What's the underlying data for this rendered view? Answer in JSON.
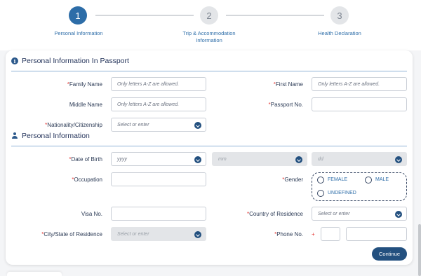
{
  "stepper": {
    "steps": [
      {
        "number": "1",
        "label": "Personal Information"
      },
      {
        "number": "2",
        "label": "Trip & Accommodation Information"
      },
      {
        "number": "3",
        "label": "Health Declaration"
      }
    ]
  },
  "passport_section": {
    "title": "Personal Information In Passport",
    "family_name": {
      "label": "Family Name",
      "placeholder": "Only letters A-Z are allowed."
    },
    "first_name": {
      "label": "First Name",
      "placeholder": "Only letters A-Z are allowed."
    },
    "middle_name": {
      "label": "Middle Name",
      "placeholder": "Only letters A-Z are allowed."
    },
    "passport_no": {
      "label": "Passport No.",
      "placeholder": ""
    },
    "nationality": {
      "label": "Nationality/Citizenship",
      "placeholder": "Select or enter"
    }
  },
  "personal_section": {
    "title": "Personal Information",
    "dob": {
      "label": "Date of Birth",
      "year": "yyyy",
      "month": "mm",
      "day": "dd"
    },
    "occupation": {
      "label": "Occupation"
    },
    "gender": {
      "label": "Gender",
      "options": [
        "FEMALE",
        "MALE",
        "UNDEFINED"
      ]
    },
    "visa_no": {
      "label": "Visa No."
    },
    "country_residence": {
      "label": "Country of Residence",
      "placeholder": "Select or enter"
    },
    "city_residence": {
      "label": "City/State of Residence",
      "placeholder": "Select or enter"
    },
    "phone_no": {
      "label": "Phone No.",
      "prefix": "+"
    }
  },
  "actions": {
    "continue_label": "Continue"
  },
  "required_mark": "*"
}
